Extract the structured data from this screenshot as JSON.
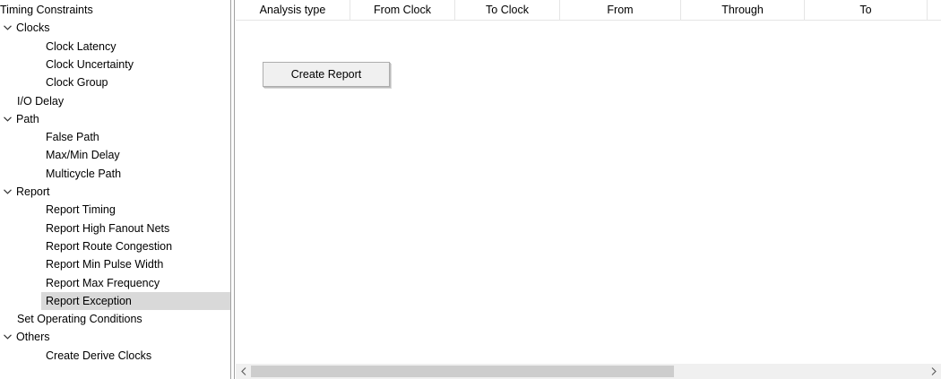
{
  "tree": {
    "items": [
      {
        "label": "Timing Constraints",
        "level": 0,
        "expander": false,
        "selected": false
      },
      {
        "label": "Clocks",
        "level": 0,
        "expander": true,
        "selected": false
      },
      {
        "label": "Clock Latency",
        "level": 2,
        "expander": false,
        "selected": false
      },
      {
        "label": "Clock Uncertainty",
        "level": 2,
        "expander": false,
        "selected": false
      },
      {
        "label": "Clock Group",
        "level": 2,
        "expander": false,
        "selected": false
      },
      {
        "label": "I/O Delay",
        "level": 1,
        "expander": false,
        "selected": false
      },
      {
        "label": "Path",
        "level": 0,
        "expander": true,
        "selected": false
      },
      {
        "label": "False Path",
        "level": 2,
        "expander": false,
        "selected": false
      },
      {
        "label": "Max/Min Delay",
        "level": 2,
        "expander": false,
        "selected": false
      },
      {
        "label": "Multicycle Path",
        "level": 2,
        "expander": false,
        "selected": false
      },
      {
        "label": "Report",
        "level": 0,
        "expander": true,
        "selected": false
      },
      {
        "label": "Report Timing",
        "level": 2,
        "expander": false,
        "selected": false
      },
      {
        "label": "Report High Fanout Nets",
        "level": 2,
        "expander": false,
        "selected": false
      },
      {
        "label": "Report Route Congestion",
        "level": 2,
        "expander": false,
        "selected": false
      },
      {
        "label": "Report Min Pulse Width",
        "level": 2,
        "expander": false,
        "selected": false
      },
      {
        "label": "Report Max Frequency",
        "level": 2,
        "expander": false,
        "selected": false
      },
      {
        "label": "Report Exception",
        "level": 2,
        "expander": false,
        "selected": true
      },
      {
        "label": "Set Operating Conditions",
        "level": 1,
        "expander": false,
        "selected": false
      },
      {
        "label": "Others",
        "level": 0,
        "expander": true,
        "selected": false
      },
      {
        "label": "Create Derive Clocks",
        "level": 2,
        "expander": false,
        "selected": false
      }
    ]
  },
  "table": {
    "columns": [
      "Analysis type",
      "From Clock",
      "To Clock",
      "From",
      "Through",
      "To"
    ]
  },
  "create_report_label": "Create Report",
  "colors": {
    "selected_row": "#d9d9d9",
    "button_face": "#f0f0f0",
    "scrollbar_track": "#f0f0f0",
    "scrollbar_thumb": "#cdcdcd"
  },
  "icons": {
    "expander": "chevron-down-icon",
    "scroll_left": "chevron-left-icon",
    "scroll_right": "chevron-right-icon"
  }
}
